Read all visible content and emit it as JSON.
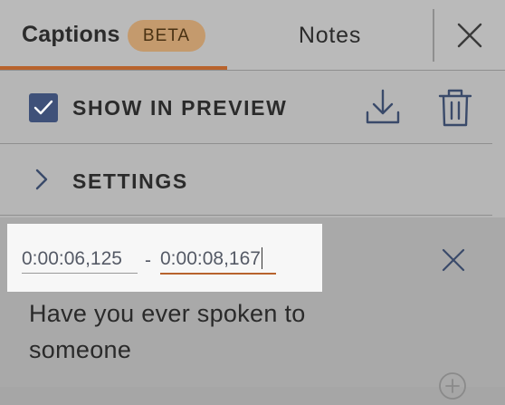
{
  "tabs": {
    "captions_label": "Captions",
    "beta_badge": "BETA",
    "notes_label": "Notes"
  },
  "options": {
    "show_in_preview_label": "SHOW IN PREVIEW",
    "show_in_preview_checked": true,
    "settings_label": "SETTINGS"
  },
  "caption": {
    "start_time": "0:00:06,125",
    "separator": "-",
    "end_time": "0:00:08,167",
    "text_line1": "Have you ever spoken to",
    "text_line2": "someone"
  },
  "colors": {
    "accent": "#b8632d",
    "checkbox": "#3f5179",
    "beta_badge_bg": "#c49a6d"
  },
  "icons": {
    "close_panel": "close-icon",
    "checkbox": "checkmark-icon",
    "download": "download-icon",
    "delete": "trash-icon",
    "settings": "chevron-right-icon",
    "caption_close": "close-icon",
    "add": "plus-circle-icon"
  }
}
